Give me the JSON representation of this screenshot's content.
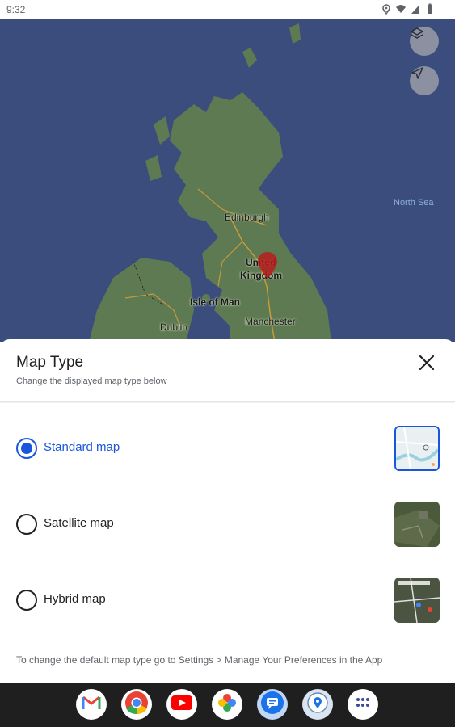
{
  "status_bar": {
    "time": "9:32",
    "icons": [
      "location-icon",
      "wifi-icon",
      "signal-icon",
      "battery-icon"
    ]
  },
  "map": {
    "labels": {
      "edinburgh": "Edinburgh",
      "united_kingdom_line1": "United",
      "united_kingdom_line2": "Kingdom",
      "isle_of_man": "Isle of Man",
      "manchester": "Manchester",
      "dublin": "Dublin",
      "north_sea": "North Sea"
    },
    "buttons": [
      "layers-icon",
      "my-location-icon"
    ],
    "colors": {
      "sea": "#3b4d7d",
      "land": "#5d7a52",
      "pin": "#b71c1c"
    }
  },
  "sheet": {
    "title": "Map Type",
    "subtitle": "Change the displayed map type below",
    "options": [
      {
        "label": "Standard map",
        "selected": true
      },
      {
        "label": "Satellite map",
        "selected": false
      },
      {
        "label": "Hybrid map",
        "selected": false
      }
    ],
    "footer": "To change the default map type go to Settings > Manage Your Preferences in the App",
    "accent_color": "#1a56db"
  },
  "dock": {
    "apps": [
      "gmail-icon",
      "chrome-icon",
      "youtube-icon",
      "photos-icon",
      "messages-icon",
      "maps-app-icon",
      "app-drawer-icon"
    ]
  }
}
